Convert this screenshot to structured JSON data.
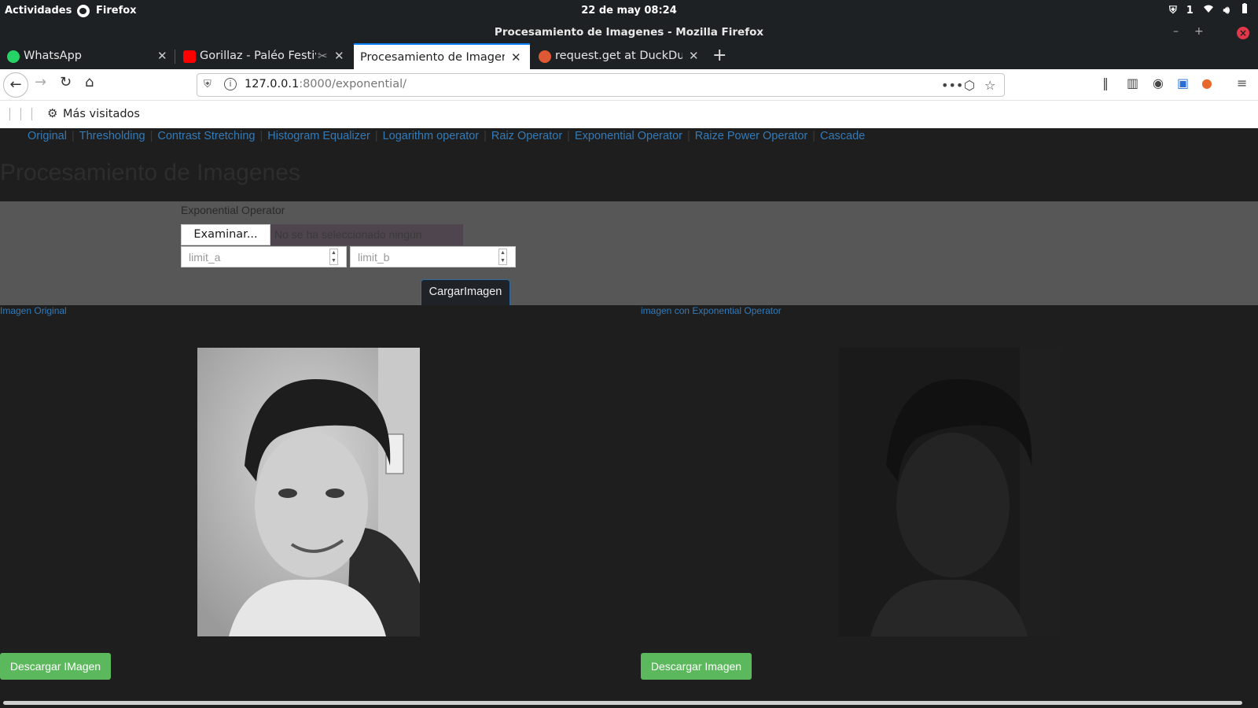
{
  "system_bar": {
    "activities": "Actividades",
    "app_name": "Firefox",
    "clock": "22 de may  08:24",
    "tray_count": "1"
  },
  "window": {
    "title": "Procesamiento de Imagenes - Mozilla Firefox"
  },
  "tabs": [
    {
      "label": "WhatsApp",
      "icon": "whatsapp-icon"
    },
    {
      "label": "Gorillaz - Paléo Festiv",
      "icon": "youtube-icon"
    },
    {
      "label": "Procesamiento de Imagen",
      "icon": "none",
      "active": true
    },
    {
      "label": "request.get at DuckDuc",
      "icon": "duckduckgo-icon"
    }
  ],
  "navigation": {
    "url_host": "127.0.0.1",
    "url_rest": ":8000/exponential/"
  },
  "bookmarks": {
    "most_visited": "Más visitados"
  },
  "page": {
    "menu": [
      "Original",
      "Thresholding",
      "Contrast Stretching",
      "Histogram Equalizer",
      "Logarithm operator",
      "Raiz Operator",
      "Exponential Operator",
      "Raize Power Operator",
      "Cascade"
    ],
    "title": "Procesamiento de Imagenes",
    "form": {
      "operator_label": "Exponential Operator",
      "browse_label": "Examinar...",
      "no_file_text": "No se ha seleccionado ningún archivo.",
      "limit_a_placeholder": "limit_a",
      "limit_b_placeholder": "limit_b",
      "submit_label": "CargarImagen"
    },
    "original_caption": "Imagen Original",
    "processed_caption": "imagen con Exponential Operator",
    "download_original": "Descargar IMagen",
    "download_processed": "Descargar Imagen"
  },
  "colors": {
    "link": "#337ab7",
    "download_button": "#5cb85c",
    "tab_accent": "#0a84ff",
    "page_bg": "#1e1e1e",
    "form_band": "#575757"
  }
}
